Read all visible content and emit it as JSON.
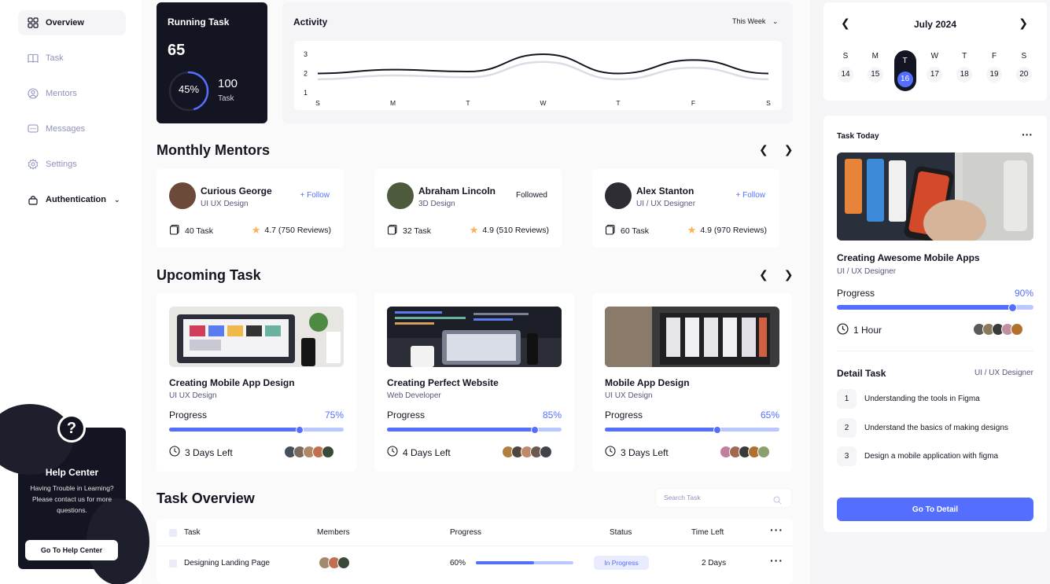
{
  "sidebar": {
    "items": [
      {
        "label": "Overview",
        "icon": "grid-icon"
      },
      {
        "label": "Task",
        "icon": "book-icon"
      },
      {
        "label": "Mentors",
        "icon": "user-icon"
      },
      {
        "label": "Messages",
        "icon": "chat-icon"
      },
      {
        "label": "Settings",
        "icon": "gear-icon"
      },
      {
        "label": "Authentication",
        "icon": "lock-icon"
      }
    ],
    "help": {
      "badge": "?",
      "title": "Help Center",
      "text": "Having Trouble in Learning? Please contact us for more questions.",
      "button": "Go To Help Center"
    }
  },
  "running_task": {
    "title": "Running Task",
    "count": "65",
    "percent_label": "45%",
    "percent": 45,
    "total": "100",
    "total_label": "Task"
  },
  "activity": {
    "title": "Activity",
    "range": "This Week"
  },
  "chart_data": {
    "type": "line",
    "categories": [
      "S",
      "M",
      "T",
      "W",
      "T",
      "F",
      "S"
    ],
    "series": [
      {
        "values": [
          2.0,
          2.2,
          2.1,
          3.0,
          2.0,
          2.7,
          2.0
        ],
        "color": "#141522"
      },
      {
        "values": [
          1.7,
          1.9,
          1.8,
          2.6,
          1.7,
          2.3,
          1.7
        ],
        "color": "#dcdce6"
      }
    ],
    "yticks": [
      "1",
      "2",
      "3"
    ],
    "ylim": [
      1,
      3
    ]
  },
  "mentors": {
    "title": "Monthly Mentors",
    "cards": [
      {
        "name": "Curious George",
        "role": "UI UX Design",
        "follow": "+ Follow",
        "tasks": "40 Task",
        "rating": "4.7 (750 Reviews)",
        "avatar_color": "#6b4a3a"
      },
      {
        "name": "Abraham Lincoln",
        "role": "3D Design",
        "follow": "Followed",
        "tasks": "32 Task",
        "rating": "4.9 (510 Reviews)",
        "avatar_color": "#4d5a3c"
      },
      {
        "name": "Alex Stanton",
        "role": "UI / UX Designer",
        "follow": "+ Follow",
        "tasks": "60 Task",
        "rating": "4.9 (970 Reviews)",
        "avatar_color": "#2d2d33"
      }
    ]
  },
  "upcoming": {
    "title": "Upcoming Task",
    "progress_label": "Progress",
    "cards": [
      {
        "title": "Creating Mobile App Design",
        "sub": "UI UX Design",
        "progress": "75%",
        "fill": 75,
        "time": "3 Days Left"
      },
      {
        "title": "Creating Perfect Website",
        "sub": "Web Developer",
        "progress": "85%",
        "fill": 85,
        "time": "4 Days Left"
      },
      {
        "title": "Mobile App Design",
        "sub": "UI UX Design",
        "progress": "65%",
        "fill": 65,
        "time": "3 Days Left"
      }
    ]
  },
  "overview": {
    "title": "Task Overview",
    "search_placeholder": "Search Task",
    "headers": {
      "task": "Task",
      "members": "Members",
      "progress": "Progress",
      "status": "Status",
      "time": "Time Left"
    },
    "rows": [
      {
        "task": "Designing Landing Page",
        "progress": "60%",
        "fill": 60,
        "status": "In Progress",
        "time": "2 Days"
      }
    ]
  },
  "calendar": {
    "month": "July 2024",
    "days": [
      {
        "name": "S",
        "date": "14"
      },
      {
        "name": "M",
        "date": "15"
      },
      {
        "name": "T",
        "date": "16"
      },
      {
        "name": "W",
        "date": "17"
      },
      {
        "name": "T",
        "date": "18"
      },
      {
        "name": "F",
        "date": "19"
      },
      {
        "name": "S",
        "date": "20"
      }
    ],
    "selected_index": 2
  },
  "today": {
    "title": "Task Today",
    "task_title": "Creating Awesome Mobile Apps",
    "task_sub": "UI / UX Designer",
    "progress_label": "Progress",
    "progress": "90%",
    "fill": 90,
    "time": "1 Hour",
    "detail_title": "Detail Task",
    "detail_role": "UI / UX Designer",
    "steps": [
      {
        "num": "1",
        "text": "Understanding the tools in Figma"
      },
      {
        "num": "2",
        "text": "Understand the basics of making designs"
      },
      {
        "num": "3",
        "text": "Design a mobile application with figma"
      }
    ],
    "button": "Go To Detail"
  },
  "colors": {
    "accent": "#546fff",
    "dark": "#141522",
    "muted": "#8e92bc"
  }
}
